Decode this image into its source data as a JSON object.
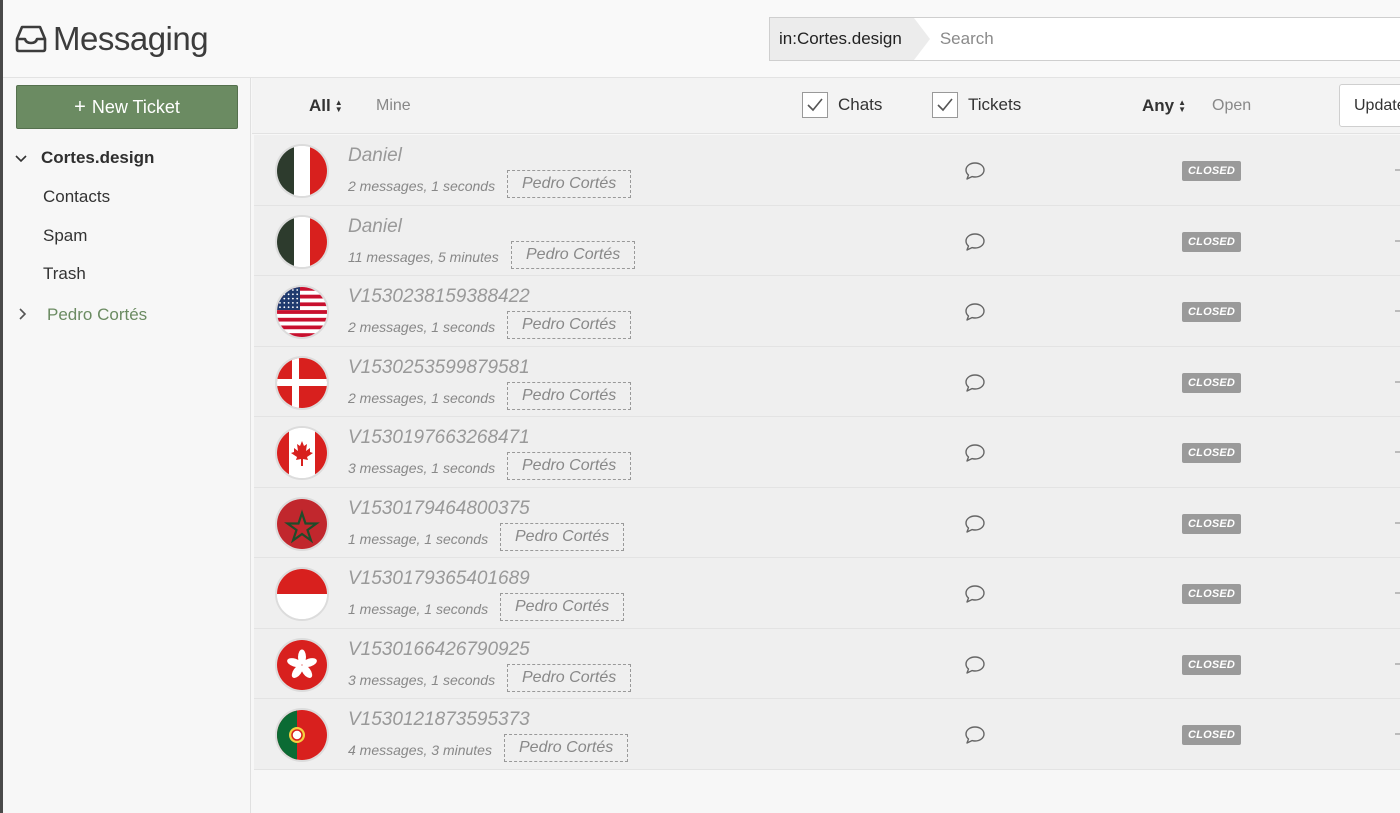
{
  "app": {
    "title": "Messaging",
    "logo_icon": "inbox-icon"
  },
  "search": {
    "scope": "in:Cortes.design",
    "placeholder": "Search",
    "value": ""
  },
  "sidebar": {
    "new_ticket": "New Ticket",
    "root": "Cortes.design",
    "items": [
      "Contacts",
      "Spam",
      "Trash"
    ],
    "agent": "Pedro Cortés"
  },
  "filters": {
    "all": "All",
    "mine": "Mine",
    "chats": {
      "label": "Chats",
      "checked": true
    },
    "tickets": {
      "label": "Tickets",
      "checked": true
    },
    "any": "Any",
    "open": "Open",
    "update": "Update"
  },
  "colors": {
    "accent": "#6b8b62",
    "status_closed": "#9a9a9a"
  },
  "tickets": [
    {
      "name": "Daniel",
      "meta": "2 messages, 1 seconds",
      "agent": "Pedro Cortés",
      "status": "CLOSED",
      "flag": "italy"
    },
    {
      "name": "Daniel",
      "meta": "11 messages, 5 minutes",
      "agent": "Pedro Cortés",
      "status": "CLOSED",
      "flag": "italy"
    },
    {
      "name": "V1530238159388422",
      "meta": "2 messages, 1 seconds",
      "agent": "Pedro Cortés",
      "status": "CLOSED",
      "flag": "usa"
    },
    {
      "name": "V1530253599879581",
      "meta": "2 messages, 1 seconds",
      "agent": "Pedro Cortés",
      "status": "CLOSED",
      "flag": "denmark"
    },
    {
      "name": "V1530197663268471",
      "meta": "3 messages, 1 seconds",
      "agent": "Pedro Cortés",
      "status": "CLOSED",
      "flag": "canada"
    },
    {
      "name": "V1530179464800375",
      "meta": "1 message, 1 seconds",
      "agent": "Pedro Cortés",
      "status": "CLOSED",
      "flag": "morocco"
    },
    {
      "name": "V1530179365401689",
      "meta": "1 message, 1 seconds",
      "agent": "Pedro Cortés",
      "status": "CLOSED",
      "flag": "indonesia"
    },
    {
      "name": "V1530166426790925",
      "meta": "3 messages, 1 seconds",
      "agent": "Pedro Cortés",
      "status": "CLOSED",
      "flag": "hong-kong"
    },
    {
      "name": "V1530121873595373",
      "meta": "4 messages, 3 minutes",
      "agent": "Pedro Cortés",
      "status": "CLOSED",
      "flag": "portugal"
    }
  ]
}
